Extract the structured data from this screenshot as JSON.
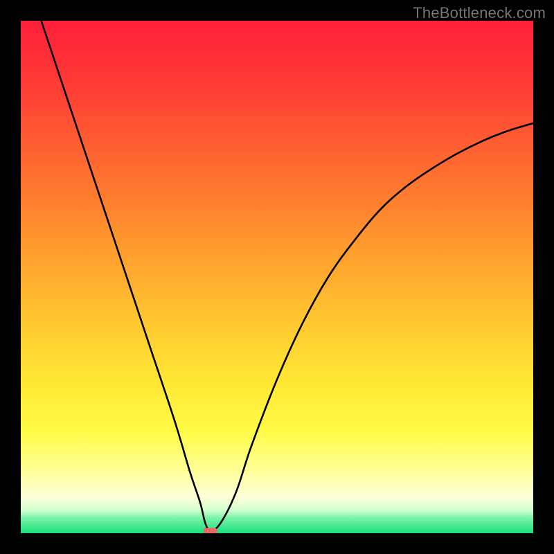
{
  "watermark": "TheBottleneck.com",
  "chart_data": {
    "type": "line",
    "title": "",
    "xlabel": "",
    "ylabel": "",
    "xlim": [
      0,
      100
    ],
    "ylim": [
      0,
      100
    ],
    "grid": false,
    "legend": false,
    "series": [
      {
        "name": "curve",
        "x": [
          4,
          10,
          15,
          20,
          25,
          30,
          33,
          35,
          36,
          37,
          39,
          42,
          45,
          50,
          55,
          60,
          65,
          70,
          75,
          80,
          85,
          90,
          95,
          100
        ],
        "y": [
          100,
          82,
          67,
          52,
          37,
          22,
          12,
          6,
          2,
          0.5,
          2,
          8,
          17,
          30,
          41,
          50,
          57,
          63,
          67.5,
          71,
          74,
          76.5,
          78.5,
          80
        ]
      }
    ],
    "marker": {
      "x": 37,
      "y": 0.5,
      "color": "#e96a63",
      "shape": "rounded-bar"
    },
    "background_gradient": {
      "top_color": "#ff1f3a",
      "mid_colors": [
        "#ff5e33",
        "#ff9a2e",
        "#ffd433",
        "#fff22f",
        "#ffff66",
        "#fcffc4"
      ],
      "bottom_color": "#18e07a",
      "green_band_start_y": 4,
      "green_band_end_y": 0
    }
  }
}
